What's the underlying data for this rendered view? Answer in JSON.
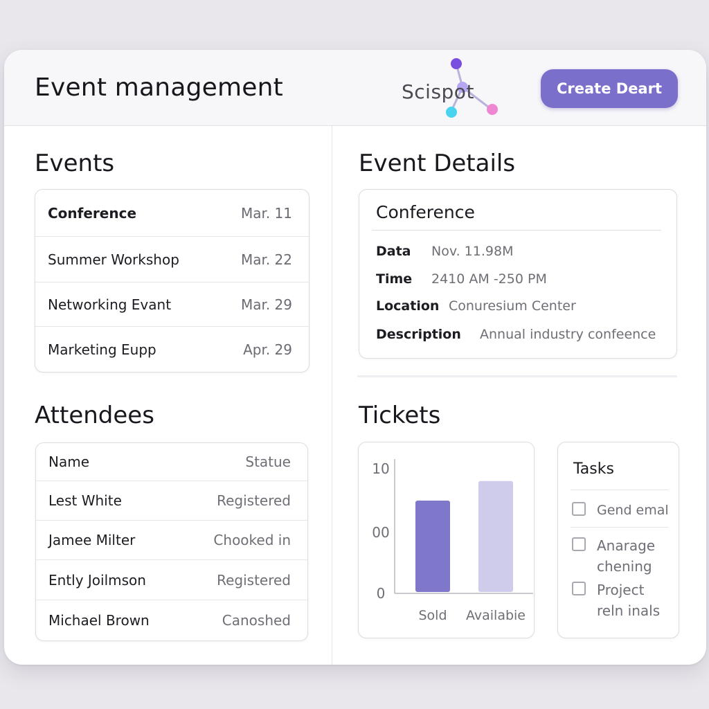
{
  "header": {
    "title": "Event management",
    "logo_text": "Scispot",
    "create_button": "Create Deart",
    "accent": "#7b6fcc"
  },
  "events": {
    "title": "Events",
    "items": [
      {
        "name": "Conference",
        "date": "Mar. 11"
      },
      {
        "name": "Summer Workshop",
        "date": "Mar. 22"
      },
      {
        "name": "Networking Evant",
        "date": "Mar. 29"
      },
      {
        "name": "Marketing Eupp",
        "date": "Apr. 29"
      }
    ]
  },
  "details": {
    "title": "Event Details",
    "event_name": "Conference",
    "fields": [
      {
        "label": "Data",
        "value": "Nov. 11.98M"
      },
      {
        "label": "Time",
        "value": "2410 AM -250 PM"
      },
      {
        "label": "Location",
        "value": "Conuresium Center"
      },
      {
        "label": "Description",
        "value": "Annual industry confeence"
      }
    ]
  },
  "attendees": {
    "title": "Attendees",
    "headers": {
      "name": "Name",
      "status": "Statue"
    },
    "rows": [
      {
        "name": "Lest White",
        "status": "Registered"
      },
      {
        "name": "Jamee Milter",
        "status": "Chooked in"
      },
      {
        "name": "Ently Joilmson",
        "status": "Registered"
      },
      {
        "name": "Michael Brown",
        "status": "Canoshed"
      }
    ]
  },
  "tickets": {
    "title": "Tickets",
    "chart_data": {
      "type": "bar",
      "categories": [
        "Sold",
        "Availabie"
      ],
      "values": [
        7.6,
        9.2
      ],
      "yticks": [
        "10",
        "00",
        "0"
      ],
      "ylim": [
        0,
        11
      ],
      "colors": [
        "#7f77c9",
        "#cfcbeb"
      ]
    }
  },
  "tasks": {
    "title": "Tasks",
    "items": [
      {
        "label": "Gend emal"
      },
      {
        "label": "Anarage chening"
      },
      {
        "label": "Project reln inals"
      }
    ]
  }
}
